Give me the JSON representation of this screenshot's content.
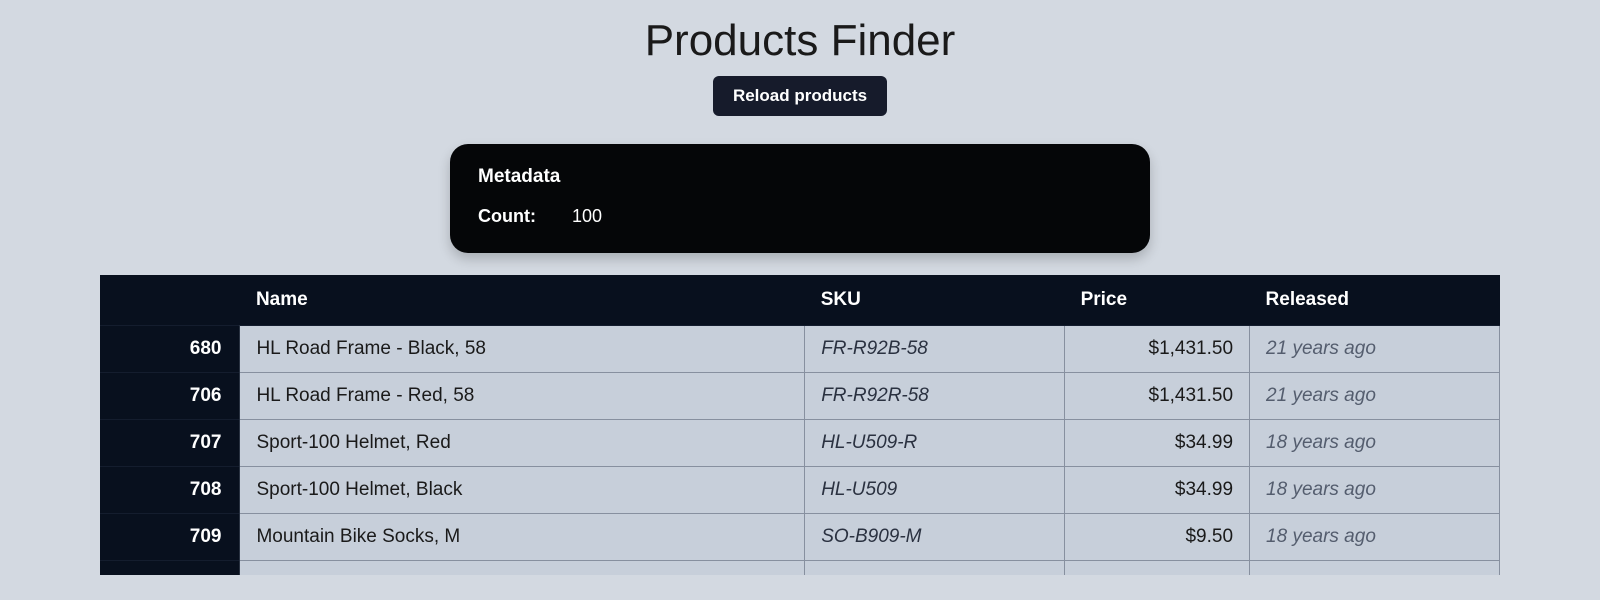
{
  "header": {
    "title": "Products Finder",
    "reload_label": "Reload products"
  },
  "metadata": {
    "title": "Metadata",
    "count_label": "Count:",
    "count_value": "100"
  },
  "table": {
    "columns": {
      "id": "",
      "name": "Name",
      "sku": "SKU",
      "price": "Price",
      "released": "Released"
    },
    "rows": [
      {
        "id": "680",
        "name": "HL Road Frame - Black, 58",
        "sku": "FR-R92B-58",
        "price": "$1,431.50",
        "released": "21 years ago"
      },
      {
        "id": "706",
        "name": "HL Road Frame - Red, 58",
        "sku": "FR-R92R-58",
        "price": "$1,431.50",
        "released": "21 years ago"
      },
      {
        "id": "707",
        "name": "Sport-100 Helmet, Red",
        "sku": "HL-U509-R",
        "price": "$34.99",
        "released": "18 years ago"
      },
      {
        "id": "708",
        "name": "Sport-100 Helmet, Black",
        "sku": "HL-U509",
        "price": "$34.99",
        "released": "18 years ago"
      },
      {
        "id": "709",
        "name": "Mountain Bike Socks, M",
        "sku": "SO-B909-M",
        "price": "$9.50",
        "released": "18 years ago"
      }
    ]
  }
}
